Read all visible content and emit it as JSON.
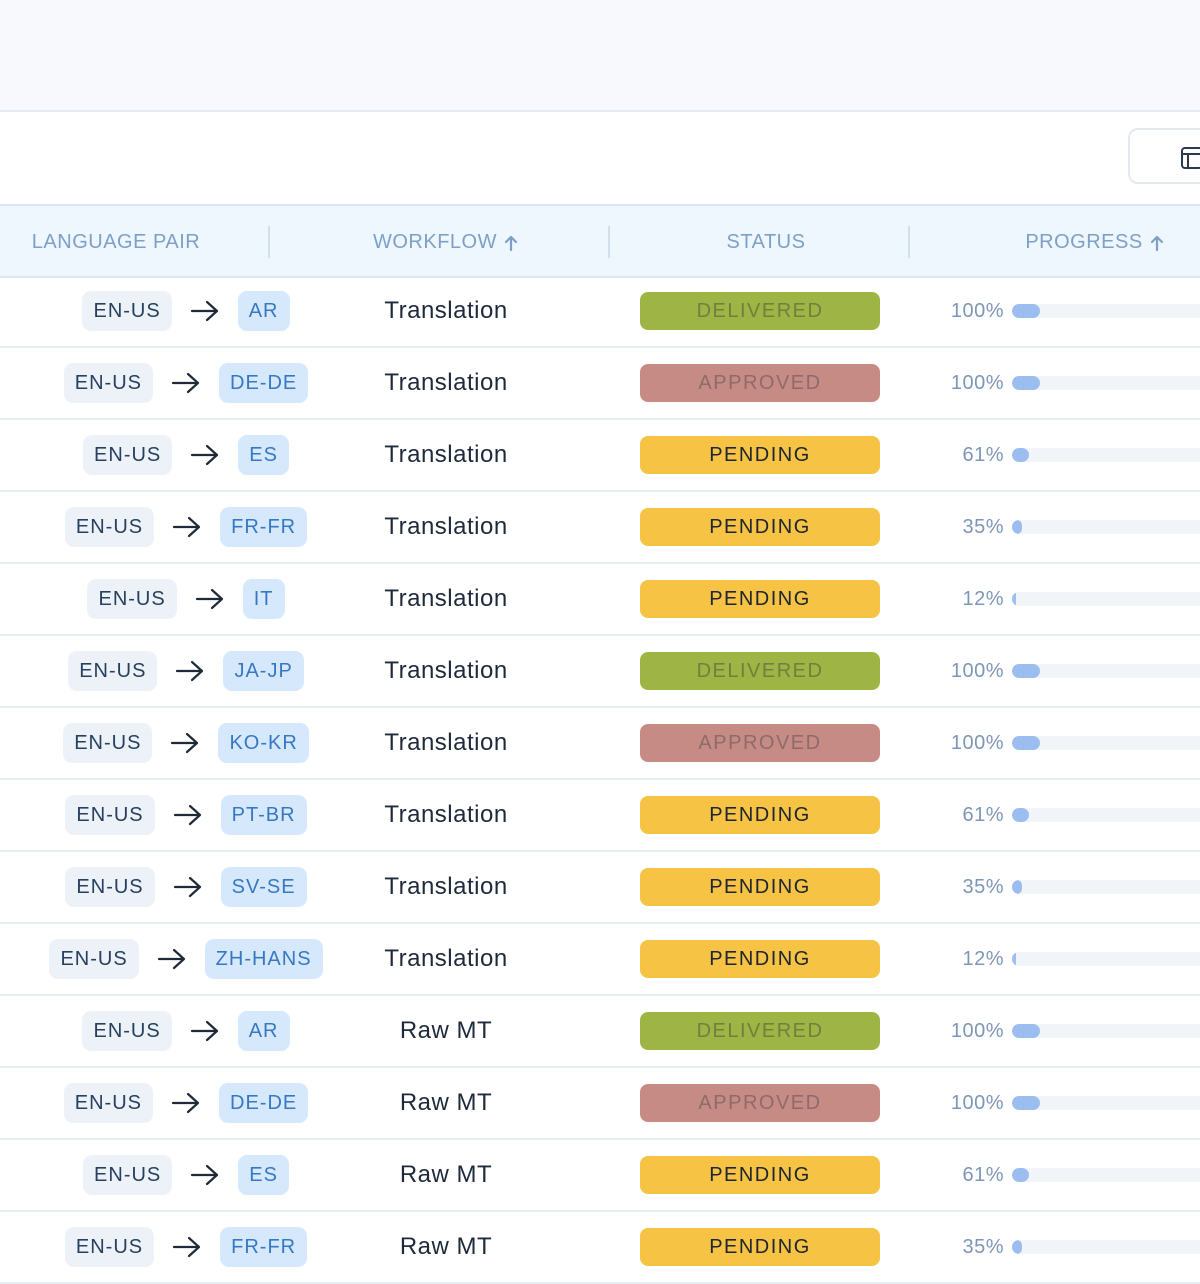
{
  "colors": {
    "delivered": "#9eb545",
    "approved": "#c78b86",
    "pending": "#f6c344",
    "delivered_text": "#6f8040",
    "approved_text": "#8e6b6b",
    "pending_text": "#1e2430",
    "progress_fill": "#9bbdf0"
  },
  "table": {
    "columns": [
      {
        "label": "LANGUAGE PAIR",
        "sort": ""
      },
      {
        "label": "WORKFLOW",
        "sort": "arrow-up-icon"
      },
      {
        "label": "STATUS",
        "sort": ""
      },
      {
        "label": "PROGRESS",
        "sort": "arrow-up-icon"
      }
    ],
    "rows": [
      {
        "src": "EN-US",
        "tgt": "AR",
        "workflow": "Translation",
        "status": "DELIVERED",
        "progress_label": "100%",
        "progress": 100
      },
      {
        "src": "EN-US",
        "tgt": "DE-DE",
        "workflow": "Translation",
        "status": "APPROVED",
        "progress_label": "100%",
        "progress": 100
      },
      {
        "src": "EN-US",
        "tgt": "ES",
        "workflow": "Translation",
        "status": "PENDING",
        "progress_label": "61%",
        "progress": 61
      },
      {
        "src": "EN-US",
        "tgt": "FR-FR",
        "workflow": "Translation",
        "status": "PENDING",
        "progress_label": "35%",
        "progress": 35
      },
      {
        "src": "EN-US",
        "tgt": "IT",
        "workflow": "Translation",
        "status": "PENDING",
        "progress_label": "12%",
        "progress": 12
      },
      {
        "src": "EN-US",
        "tgt": "JA-JP",
        "workflow": "Translation",
        "status": "DELIVERED",
        "progress_label": "100%",
        "progress": 100
      },
      {
        "src": "EN-US",
        "tgt": "KO-KR",
        "workflow": "Translation",
        "status": "APPROVED",
        "progress_label": "100%",
        "progress": 100
      },
      {
        "src": "EN-US",
        "tgt": "PT-BR",
        "workflow": "Translation",
        "status": "PENDING",
        "progress_label": "61%",
        "progress": 61
      },
      {
        "src": "EN-US",
        "tgt": "SV-SE",
        "workflow": "Translation",
        "status": "PENDING",
        "progress_label": "35%",
        "progress": 35
      },
      {
        "src": "EN-US",
        "tgt": "ZH-HANS",
        "workflow": "Translation",
        "status": "PENDING",
        "progress_label": "12%",
        "progress": 12
      },
      {
        "src": "EN-US",
        "tgt": "AR",
        "workflow": "Raw MT",
        "status": "DELIVERED",
        "progress_label": "100%",
        "progress": 100
      },
      {
        "src": "EN-US",
        "tgt": "DE-DE",
        "workflow": "Raw MT",
        "status": "APPROVED",
        "progress_label": "100%",
        "progress": 100
      },
      {
        "src": "EN-US",
        "tgt": "ES",
        "workflow": "Raw MT",
        "status": "PENDING",
        "progress_label": "61%",
        "progress": 61
      },
      {
        "src": "EN-US",
        "tgt": "FR-FR",
        "workflow": "Raw MT",
        "status": "PENDING",
        "progress_label": "35%",
        "progress": 35
      }
    ]
  },
  "toolbar": {
    "layout_icon": "layout-icon"
  }
}
